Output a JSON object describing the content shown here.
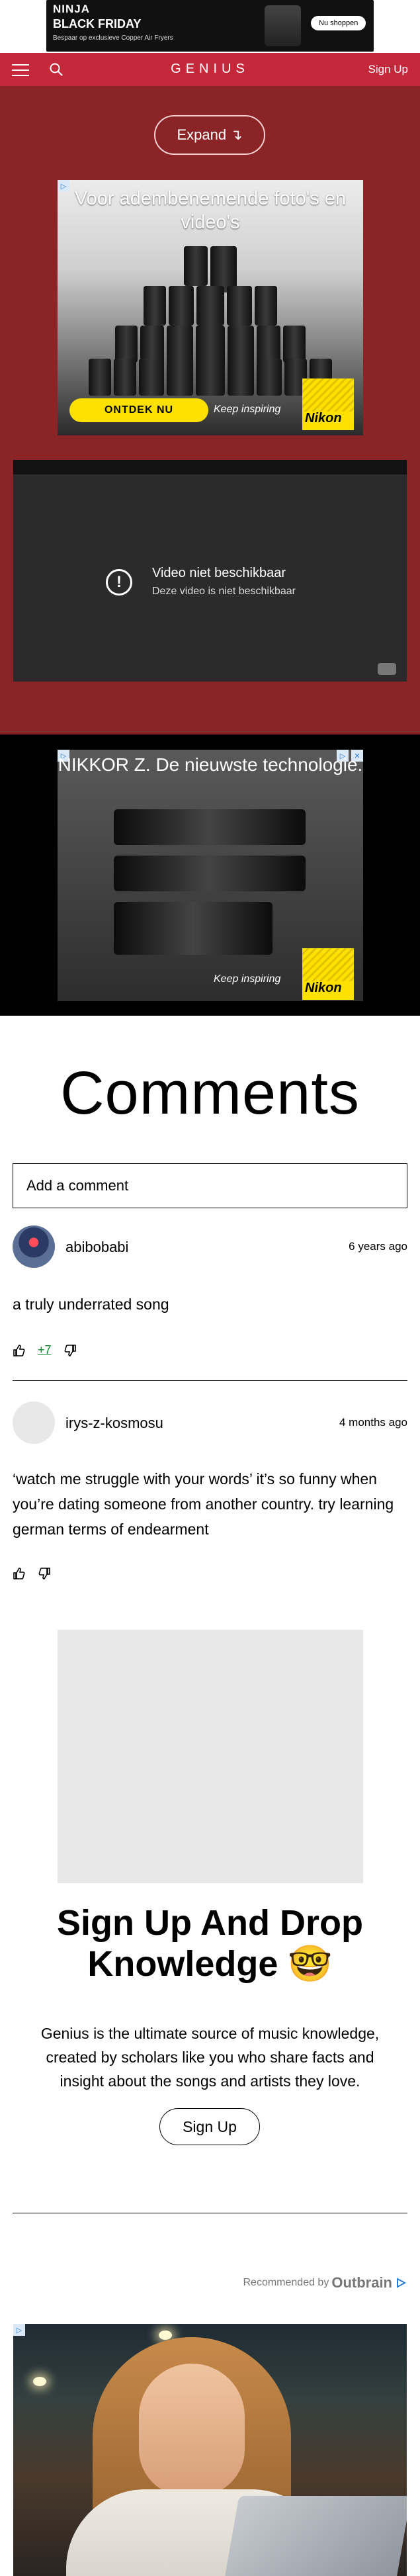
{
  "top_ad": {
    "brand": "NINJA",
    "headline": "BLACK FRIDAY",
    "subline": "Bespaar op exclusieve Copper Air Fryers",
    "cta": "Nu shoppen"
  },
  "header": {
    "logo": "GENIUS",
    "signup": "Sign Up"
  },
  "expand": {
    "label": "Expand",
    "icon": "↴"
  },
  "ad1": {
    "title": "Voor adembenemende foto's en video's",
    "cta": "ONTDEK NU",
    "slogan": "Keep inspiring",
    "brand": "Nikon"
  },
  "video": {
    "title": "Video niet beschikbaar",
    "subtitle": "Deze video is niet beschikbaar"
  },
  "ad2": {
    "title": "NIKKOR Z. De nieuwste technologie.",
    "slogan": "Keep inspiring",
    "brand": "Nikon"
  },
  "comments": {
    "title": "Comments",
    "add_placeholder": "Add a comment",
    "items": [
      {
        "user": "abibobabi",
        "time": "6 years ago",
        "body": "a truly underrated song",
        "votes": "+7"
      },
      {
        "user": "irys-z-kosmosu",
        "time": "4 months ago",
        "body": "‘watch me struggle with your words’ it’s so funny when you’re dating someone from another country. try learning german terms of endearment",
        "votes": ""
      }
    ]
  },
  "signup": {
    "title": "Sign Up And Drop Knowledge 🤓",
    "description": "Genius is the ultimate source of music knowledge, created by scholars like you who share facts and insight about the songs and artists they love.",
    "button": "Sign Up"
  },
  "recommended": {
    "label": "Recommended by",
    "brand": "Outbrain"
  },
  "colors": {
    "header": "#c4283a",
    "red_area": "#8b2427",
    "upvote": "#0a8a2c"
  }
}
